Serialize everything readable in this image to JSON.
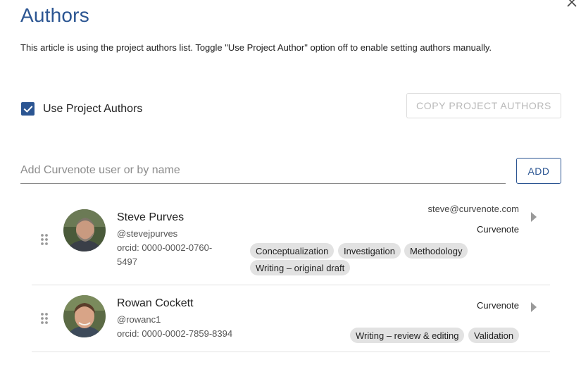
{
  "dialog": {
    "title": "Authors",
    "description": "This article is using the project authors list. Toggle \"Use Project Author\" option off to enable setting authors manually.",
    "close_icon": "close-icon"
  },
  "use_project_authors": {
    "label": "Use Project Authors",
    "checked": true
  },
  "copy_button": {
    "label": "COPY PROJECT AUTHORS",
    "disabled": true
  },
  "add_author": {
    "placeholder": "Add Curvenote user or by name",
    "value": "",
    "button_label": "ADD"
  },
  "authors": [
    {
      "name": "Steve Purves",
      "handle": "@stevejpurves",
      "orcid": "orcid: 0000-0002-0760-5497",
      "email": "steve@curvenote.com",
      "affiliation": "Curvenote",
      "roles": [
        "Conceptualization",
        "Investigation",
        "Methodology",
        "Writing – original draft"
      ]
    },
    {
      "name": "Rowan Cockett",
      "handle": "@rowanc1",
      "orcid": "orcid: 0000-0002-7859-8394",
      "email": "",
      "affiliation": "Curvenote",
      "roles": [
        "Writing – review & editing",
        "Validation"
      ]
    }
  ],
  "colors": {
    "accent": "#2b5592",
    "tag_bg": "#e2e2e2",
    "divider": "#e2e2e2"
  }
}
